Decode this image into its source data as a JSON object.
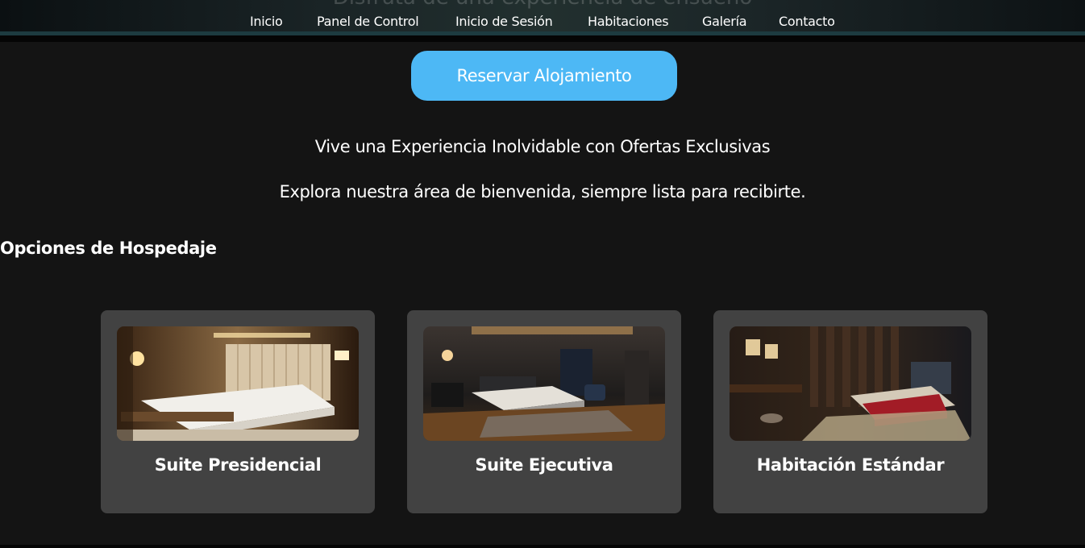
{
  "hero": {
    "ghost_text": "Disfruta de una experiencia de ensueño"
  },
  "nav": {
    "items": [
      {
        "label": "Inicio"
      },
      {
        "label": "Panel de Control"
      },
      {
        "label": "Inicio de Sesión"
      },
      {
        "label": "Habitaciones"
      },
      {
        "label": "Galería"
      },
      {
        "label": "Contacto"
      }
    ]
  },
  "main": {
    "reserve_label": "Reservar Alojamiento",
    "tagline_1": "Vive una Experiencia Inolvidable con Ofertas Exclusivas",
    "tagline_2": "Explora nuestra área de bienvenida, siempre lista para recibirte.",
    "section_title": "Opciones de Hospedaje"
  },
  "rooms": [
    {
      "title": "Suite Presidencial",
      "image": "bedroom-presidential-photo"
    },
    {
      "title": "Suite Ejecutiva",
      "image": "bedroom-executive-photo"
    },
    {
      "title": "Habitación Estándar",
      "image": "bedroom-standard-photo"
    }
  ],
  "colors": {
    "background": "#141414",
    "button": "#4db8f5",
    "card": "#424242"
  }
}
